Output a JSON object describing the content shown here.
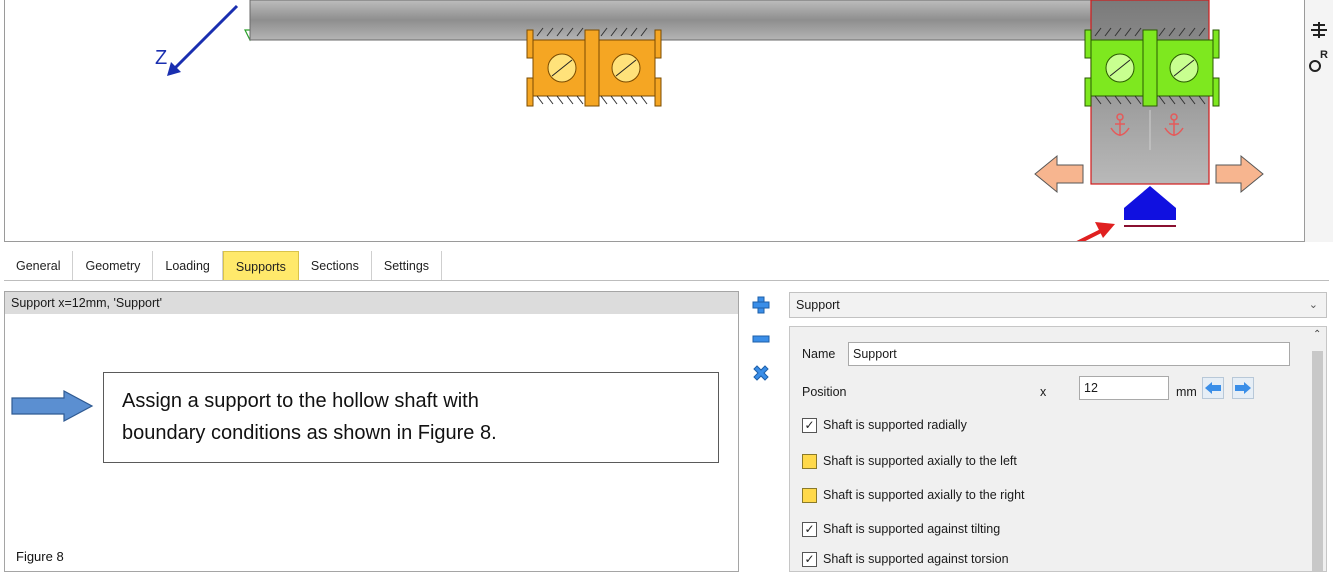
{
  "viewport": {
    "axis_label": "Z"
  },
  "tabs": [
    {
      "label": "General",
      "active": false
    },
    {
      "label": "Geometry",
      "active": false
    },
    {
      "label": "Loading",
      "active": false
    },
    {
      "label": "Supports",
      "active": true
    },
    {
      "label": "Sections",
      "active": false
    },
    {
      "label": "Settings",
      "active": false
    }
  ],
  "supports_list": {
    "items": [
      "Support  x=12mm, 'Support'"
    ]
  },
  "type_select": {
    "value": "Support"
  },
  "properties": {
    "name_label": "Name",
    "name_value": "Support",
    "position_label": "Position",
    "coord_label": "x",
    "position_value": "12",
    "unit": "mm",
    "checks": [
      {
        "label": "Shaft is supported radially",
        "checked": true
      },
      {
        "label": "Shaft is supported axially to the left",
        "checked": false
      },
      {
        "label": "Shaft is supported axially to the right",
        "checked": false
      },
      {
        "label": "Shaft is supported against tilting",
        "checked": true
      },
      {
        "label": "Shaft is supported against torsion",
        "checked": true
      }
    ]
  },
  "callout": {
    "line1": "Assign a support to the hollow shaft with",
    "line2": "boundary conditions as shown in Figure 8."
  },
  "caption": "Figure 8",
  "colors": {
    "active_tab": "#ffe96b",
    "orange_bearing": "#f5a623",
    "green_bearing": "#7ee81f",
    "support_blue": "#1010e0",
    "annotation_red": "#e02020",
    "callout_arrow": "#5b8fd1"
  },
  "icons": {
    "add": "plus-icon",
    "remove": "minus-icon",
    "delete": "x-icon",
    "left": "arrow-left-icon",
    "right": "arrow-right-icon"
  }
}
